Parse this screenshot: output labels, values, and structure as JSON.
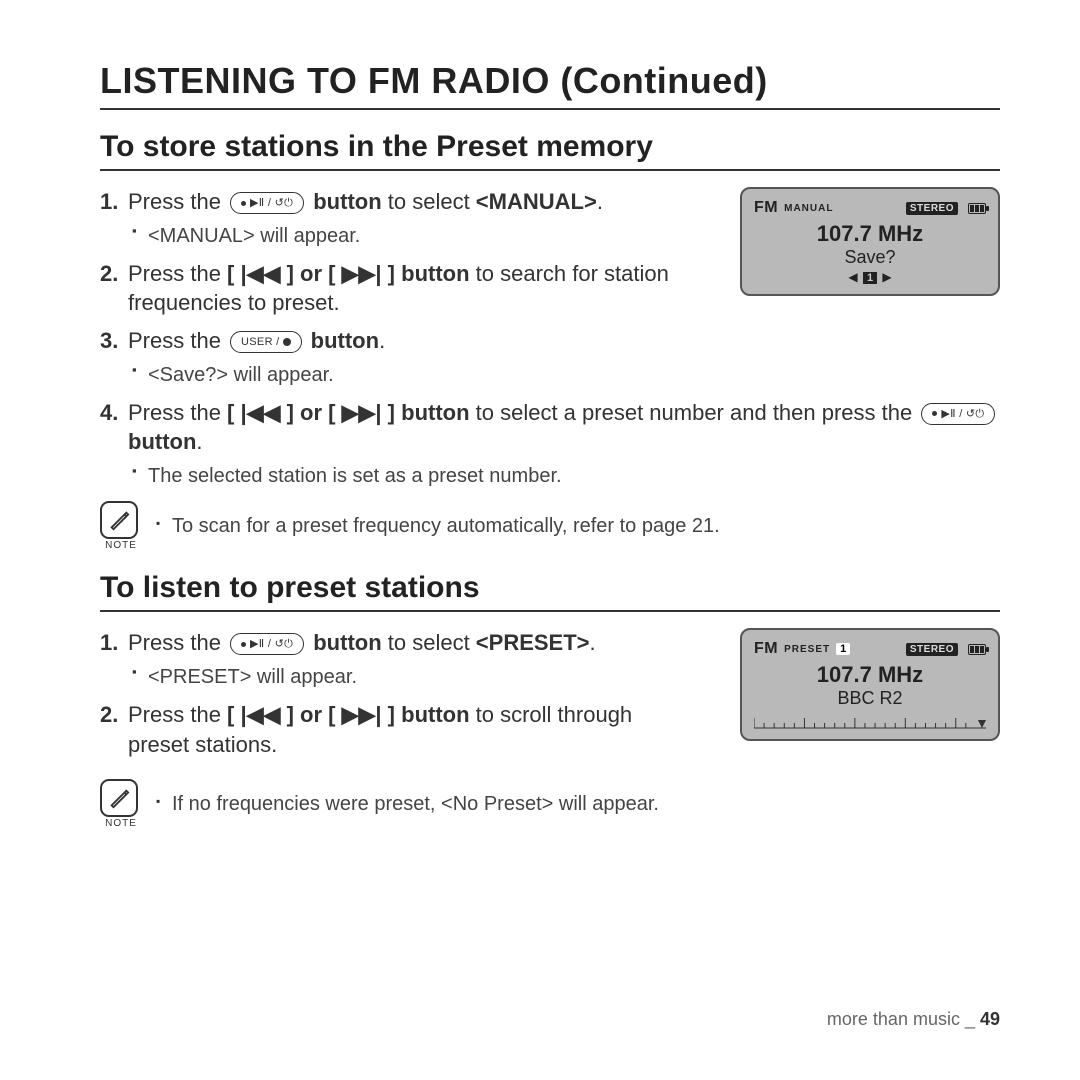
{
  "title": "LISTENING TO FM RADIO (Continued)",
  "section1": {
    "heading": "To store stations in the Preset memory",
    "steps": [
      {
        "pre": "Press the ",
        "btn": "play-pause-power",
        "post_b": " button",
        "post": " to select ",
        "tail_b": "<MANUAL>",
        "tail": ".",
        "sub": "<MANUAL> will appear."
      },
      {
        "pre": "Press the ",
        "inline_b": "[ |◀◀ ] or [ ▶▶| ] button",
        "post": " to search for station frequencies to preset."
      },
      {
        "pre": "Press the ",
        "btn": "user-rec",
        "post_b": " button",
        "tail": ".",
        "sub": "<Save?> will appear."
      },
      {
        "pre": "Press the ",
        "inline_b": "[ |◀◀ ] or [ ▶▶| ] button",
        "post": " to select a preset number and then press the ",
        "btn2": "play-pause-power",
        "post_b2": " button",
        "tail": ".",
        "sub": "The selected station is set as a preset number."
      }
    ],
    "note": "To scan for a preset frequency automatically, refer to page 21.",
    "lcd": {
      "fm": "FM",
      "mode": "MANUAL",
      "stereo": "STEREO",
      "freq": "107.7 MHz",
      "sub": "Save?",
      "sel": "1"
    }
  },
  "section2": {
    "heading": "To listen to preset stations",
    "steps": [
      {
        "pre": "Press the ",
        "btn": "play-pause-power",
        "post_b": " button",
        "post": " to select ",
        "tail_b": "<PRESET>",
        "tail": ".",
        "sub": "<PRESET> will appear."
      },
      {
        "pre": "Press the ",
        "inline_b": "[ |◀◀ ] or [ ▶▶| ] button",
        "post": " to scroll through preset stations."
      }
    ],
    "note": "If no frequencies were preset, <No Preset> will appear.",
    "lcd": {
      "fm": "FM",
      "mode": "PRESET",
      "preset_num": "1",
      "stereo": "STEREO",
      "freq": "107.7 MHz",
      "sub": "BBC R2"
    }
  },
  "note_label": "NOTE",
  "footer": {
    "text": "more than music _ ",
    "page": "49"
  }
}
